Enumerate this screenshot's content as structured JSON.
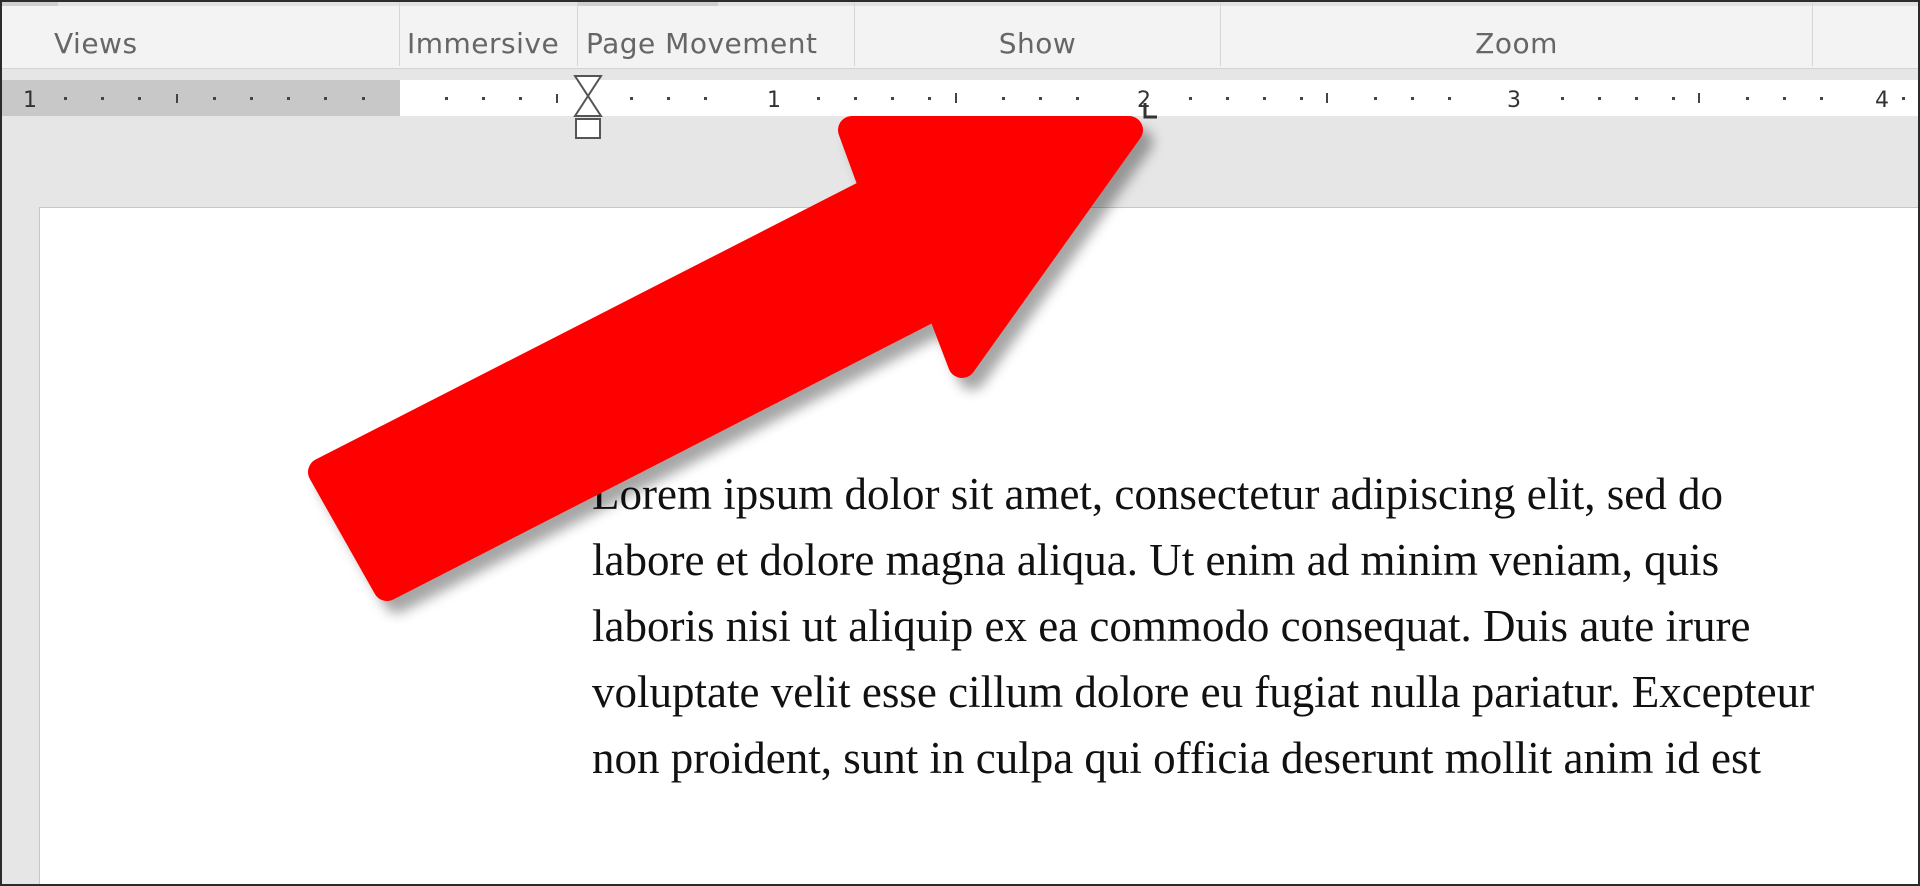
{
  "ribbon": {
    "groups": [
      {
        "label": "Views"
      },
      {
        "label": "Immersive"
      },
      {
        "label": "Page Movement"
      },
      {
        "label": "Show"
      },
      {
        "label": "Zoom"
      }
    ]
  },
  "ruler": {
    "unit_labels": [
      "1",
      "1",
      "2",
      "3",
      "4"
    ]
  },
  "document": {
    "lines": [
      "Lorem ipsum dolor sit amet, consectetur adipiscing elit, sed do",
      "labore et dolore magna aliqua. Ut enim ad minim veniam, quis",
      "laboris nisi ut aliquip ex ea commodo consequat. Duis aute irure",
      "voluptate velit esse cillum dolore eu fugiat nulla pariatur. Excepteur",
      "non proident, sunt in culpa qui officia deserunt mollit anim id est"
    ]
  },
  "colors": {
    "arrow": "#ff0000",
    "ribbon_bg": "#f3f3f3",
    "workspace_bg": "#e6e6e6",
    "ruler_margin": "#c8c8c8"
  },
  "icons": {
    "indent": "hanging-indent-marker-icon",
    "tab": "left-tab-stop-icon",
    "callout": "red-arrow-icon"
  }
}
